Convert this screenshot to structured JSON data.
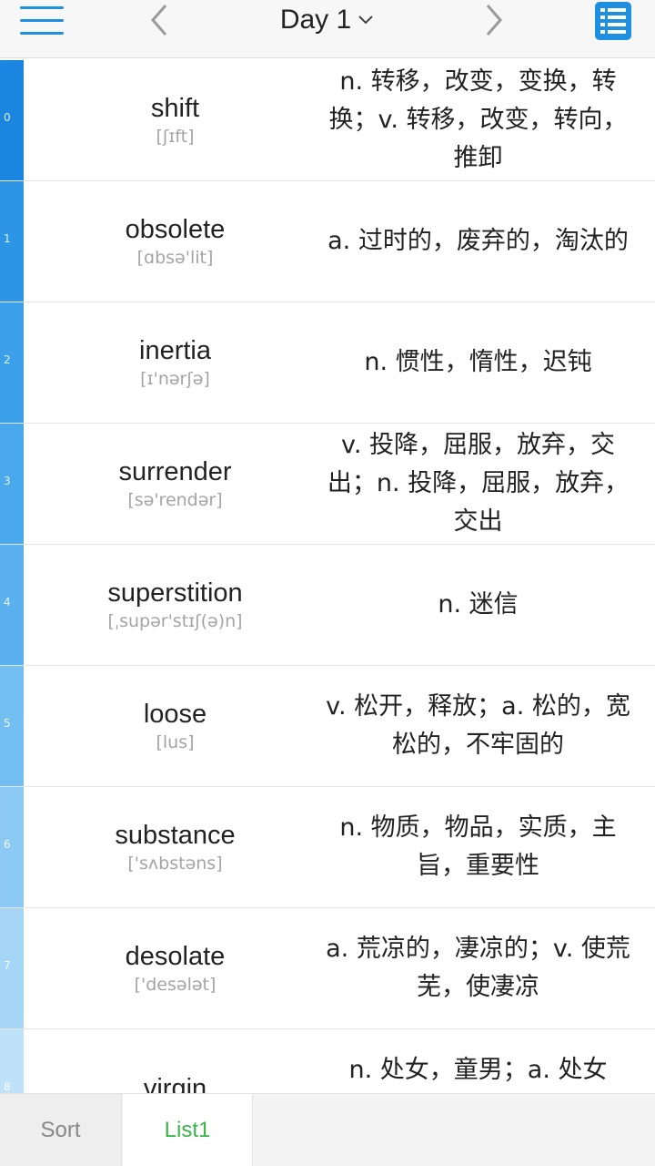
{
  "header": {
    "title": "Day 1",
    "icons": {
      "menu": "hamburger-menu-icon",
      "prev": "chevron-left-icon",
      "next": "chevron-right-icon",
      "title_dropdown": "chevron-down-icon",
      "list": "list-icon"
    }
  },
  "colors": {
    "accent": "#1e8fe1",
    "active_tab": "#3cb54a",
    "index_bar_gradient": [
      "#1a86e0",
      "#2c95e6",
      "#3b9fea",
      "#4aa8ec",
      "#5ab1ee",
      "#74bff1",
      "#8ccaf3",
      "#a6d6f6",
      "#c0e2f8"
    ]
  },
  "words": [
    {
      "index": "0",
      "word": "shift",
      "phonetic": "[ʃɪft]",
      "definition": "n. 转移，改变，变换，转换；v. 转移，改变，转向，推卸"
    },
    {
      "index": "1",
      "word": "obsolete",
      "phonetic": "[ɑbsə'lit]",
      "definition": "a. 过时的，废弃的，淘汰的"
    },
    {
      "index": "2",
      "word": "inertia",
      "phonetic": "[ɪ'nərʃə]",
      "definition": "n. 惯性，惰性，迟钝"
    },
    {
      "index": "3",
      "word": "surrender",
      "phonetic": "[sə'rendər]",
      "definition": "v. 投降，屈服，放弃，交出；n. 投降，屈服，放弃，交出"
    },
    {
      "index": "4",
      "word": "superstition",
      "phonetic": "[ˌsupər'stɪʃ(ə)n]",
      "definition": "n. 迷信"
    },
    {
      "index": "5",
      "word": "loose",
      "phonetic": "[lus]",
      "definition": "v. 松开，释放；a. 松的，宽松的，不牢固的"
    },
    {
      "index": "6",
      "word": "substance",
      "phonetic": "['sʌbstəns]",
      "definition": "n. 物质，物品，实质，主旨，重要性"
    },
    {
      "index": "7",
      "word": "desolate",
      "phonetic": "['desələt]",
      "definition": "a. 荒凉的，凄凉的；v. 使荒芜，使凄凉"
    },
    {
      "index": "8",
      "word": "virgin",
      "phonetic": "",
      "definition": "n. 处女，童男；a. 处女的，"
    }
  ],
  "tabs": {
    "sort": "Sort",
    "list1": "List1"
  }
}
